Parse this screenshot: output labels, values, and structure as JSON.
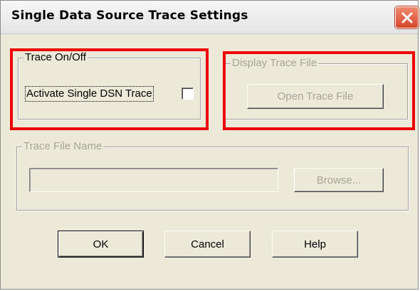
{
  "window": {
    "title": "Single Data Source Trace Settings",
    "close_icon": "close-icon"
  },
  "trace_onoff": {
    "group_label": "Trace On/Off",
    "checkbox_label": "Activate Single DSN Trace",
    "checked": false
  },
  "display_trace": {
    "group_label": "Display Trace File",
    "open_button": "Open Trace File"
  },
  "trace_file_name": {
    "group_label": "Trace File Name",
    "input_value": "",
    "browse_button": "Browse..."
  },
  "buttons": {
    "ok": "OK",
    "cancel": "Cancel",
    "help": "Help"
  },
  "colors": {
    "highlight": "#ee0000",
    "dialog_bg": "#ece9d8",
    "disabled_text": "#a7a49a"
  }
}
